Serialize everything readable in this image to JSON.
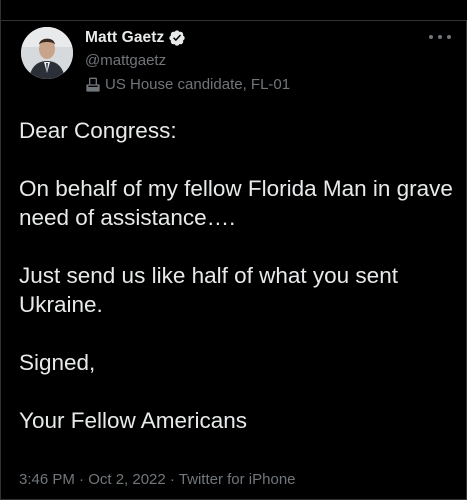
{
  "author": {
    "name": "Matt Gaetz",
    "handle": "@mattgaetz",
    "label": "US House candidate, FL-01",
    "verified": true,
    "avatar": "avatar-photo",
    "label_icon": "ballot-box-icon"
  },
  "tweet": {
    "paragraphs": [
      "Dear Congress:",
      "On behalf of my fellow Florida Man in grave need of assistance….",
      "Just send us like half of what you sent Ukraine.",
      "Signed,",
      "Your Fellow Americans"
    ]
  },
  "meta": {
    "text": "3:46 PM · Oct 2, 2022 · Twitter for iPhone"
  },
  "icons": {
    "verified": "verified-badge-icon",
    "more": "more-options-icon"
  },
  "colors": {
    "background": "#000000",
    "text": "#e7e9ea",
    "secondary": "#71767b",
    "verified_badge": "#e7e9ea"
  }
}
